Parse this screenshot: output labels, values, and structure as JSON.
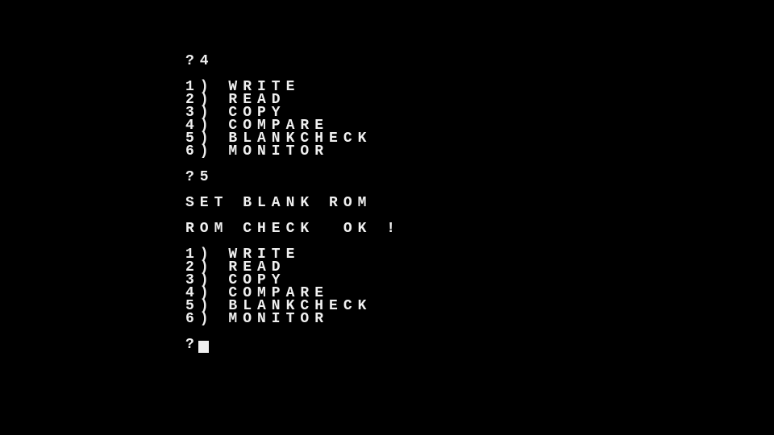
{
  "prompt1": "?4",
  "menu1": {
    "items": [
      "1) WRITE",
      "2) READ",
      "3) COPY",
      "4) COMPARE",
      "5) BLANKCHECK",
      "6) MONITOR"
    ]
  },
  "prompt2": "?5",
  "status1": "SET BLANK ROM",
  "status2": "ROM CHECK  OK !",
  "menu2": {
    "items": [
      "1) WRITE",
      "2) READ",
      "3) COPY",
      "4) COMPARE",
      "5) BLANKCHECK",
      "6) MONITOR"
    ]
  },
  "prompt3": "?"
}
